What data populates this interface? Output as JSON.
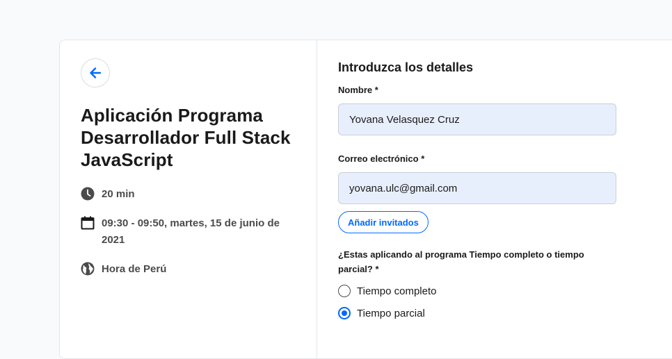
{
  "event": {
    "title": "Aplicación Programa Desarrollador Full Stack JavaScript",
    "duration": "20 min",
    "datetime": "09:30 - 09:50, martes, 15 de junio de 2021",
    "timezone": "Hora de Perú"
  },
  "form": {
    "section_title": "Introduzca los detalles",
    "name_label": "Nombre *",
    "name_value": "Yovana Velasquez Cruz",
    "email_label": "Correo electrónico *",
    "email_value": "yovana.ulc@gmail.com",
    "add_guests_label": "Añadir invitados",
    "question": "¿Estas aplicando al programa Tiempo completo o tiempo parcial? *",
    "options": [
      {
        "label": "Tiempo completo",
        "selected": false
      },
      {
        "label": "Tiempo parcial",
        "selected": true
      }
    ]
  },
  "icons": {
    "back": "arrow-left-icon",
    "duration": "clock-icon",
    "datetime": "calendar-icon",
    "timezone": "globe-icon"
  },
  "colors": {
    "accent": "#0069ff",
    "input_bg": "#e8effc",
    "text": "#1a1a1a",
    "muted": "#4b4b4b"
  }
}
